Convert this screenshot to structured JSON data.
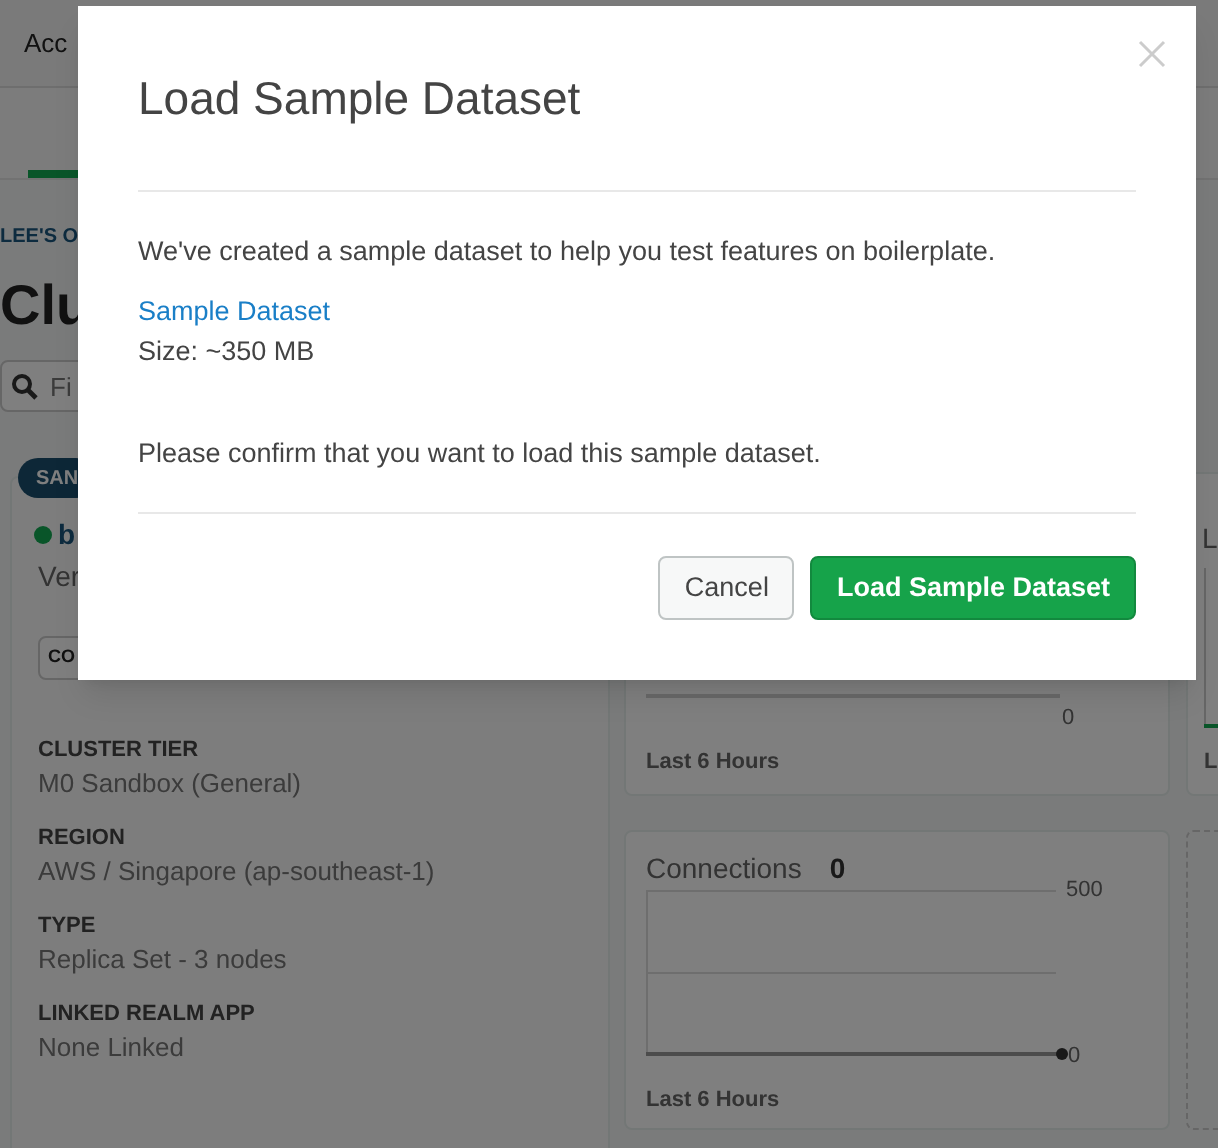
{
  "top_nav": {
    "label": "Acc"
  },
  "tabs": [
    {
      "selected": true
    }
  ],
  "breadcrumb": "LEE'S O",
  "heading": "Clu",
  "search": {
    "placeholder": "Fi"
  },
  "cluster_card": {
    "badge": "SAN",
    "name": "b",
    "version": "Ver",
    "button": "CO",
    "details": [
      {
        "label": "CLUSTER TIER",
        "value": "M0 Sandbox (General)"
      },
      {
        "label": "REGION",
        "value": "AWS / Singapore (ap-southeast-1)"
      },
      {
        "label": "TYPE",
        "value": "Replica Set - 3 nodes"
      },
      {
        "label": "LINKED REALM APP",
        "value": "None Linked"
      }
    ]
  },
  "charts": [
    {
      "kind": "partial",
      "axis_min": "0",
      "footer": "Last 6 Hours"
    },
    {
      "kind": "edge",
      "title": "L",
      "footer": "L"
    },
    {
      "kind": "full",
      "title": "Connections",
      "value": "0",
      "axis_max": "500",
      "axis_min": "0",
      "footer": "Last 6 Hours"
    },
    {
      "kind": "empty"
    }
  ],
  "modal": {
    "title": "Load Sample Dataset",
    "text": "We've created a sample dataset to help you test features on boilerplate.",
    "link": "Sample Dataset",
    "size": "Size: ~350 MB",
    "confirm": "Please confirm that you want to load this sample dataset.",
    "buttons": [
      {
        "label": "Cancel",
        "kind": "secondary"
      },
      {
        "label": "Load Sample Dataset",
        "kind": "primary"
      }
    ]
  }
}
